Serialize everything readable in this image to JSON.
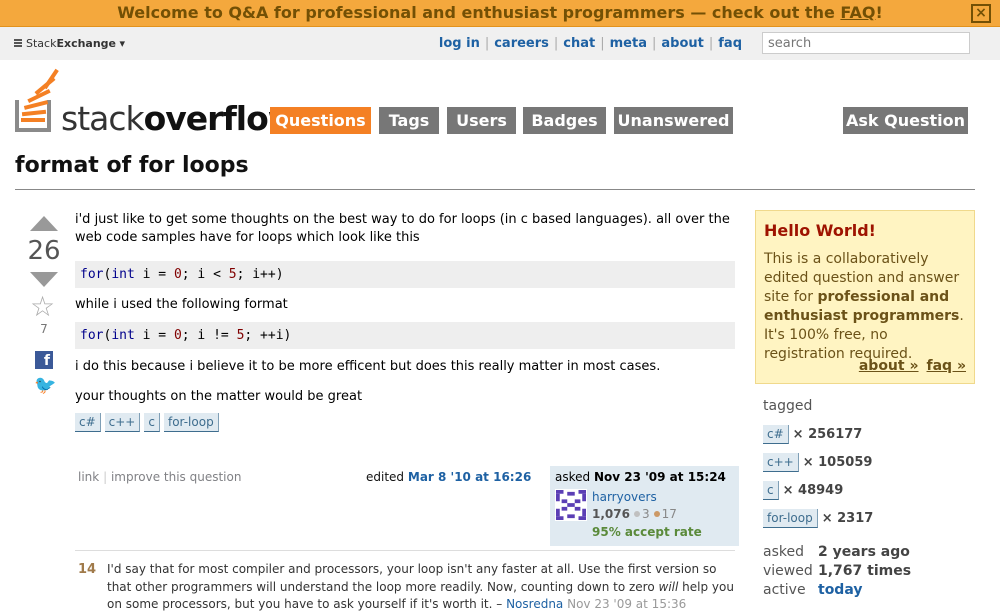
{
  "notify": {
    "text": "Welcome to Q&A for professional and enthusiast programmers — check out the ",
    "faq_link": "FAQ",
    "end": "!",
    "close": "×"
  },
  "topbar": {
    "brand": "StackExchange",
    "brand_prefix": "Stack",
    "brand_suffix": "Exchange",
    "caret": "▾",
    "links": [
      "log in",
      "careers",
      "chat",
      "meta",
      "about",
      "faq"
    ],
    "search_placeholder": "search"
  },
  "logo": {
    "light": "stack",
    "bold": "overflow"
  },
  "nav": {
    "items": [
      "Questions",
      "Tags",
      "Users",
      "Badges",
      "Unanswered"
    ],
    "ask": "Ask Question"
  },
  "question": {
    "title": "format of for loops",
    "votes": "26",
    "favorites": "7",
    "body1": "i'd just like to get some thoughts on the best way to do for loops (in c based languages). all over the web code samples have for loops which look like this",
    "code1": "for(int i = 0; i < 5; i++)",
    "body2": "while i used the following format",
    "code2": "for(int i = 0; i != 5; ++i)",
    "body3": "i do this because i believe it to be more efficent but does this really matter in most cases.",
    "body4": "your thoughts on the matter would be great",
    "tags": [
      "c#",
      "c++",
      "c",
      "for-loop"
    ],
    "menu_link": "link",
    "menu_improve": "improve this question",
    "edited_label": "edited",
    "edited_date": "Mar 8 '10 at 16:26",
    "asked_label": "asked",
    "asked_date": "Nov 23 '09 at 15:24",
    "user": "harryovers",
    "rep": "1,076",
    "silver": "3",
    "bronze": "17",
    "accept_rate": "95% accept rate"
  },
  "answer": {
    "votes": "14",
    "text_a": "I'd say that for most compiler and processors, your loop isn't any faster at all. Use the first version so that other programmers will understand the loop more readily. Now, counting down to zero ",
    "text_em": "will",
    "text_b": " help you on some processors, but you have to ask yourself if it's worth it. – ",
    "author": "Nosredna",
    "date": "Nov 23 '09 at 15:36"
  },
  "sidebar": {
    "hello_title": "Hello World!",
    "hello_text_a": "This is a collaboratively edited question and answer site for ",
    "hello_bold": "professional and enthusiast programmers",
    "hello_text_b": ". It's 100% free, no registration required.",
    "about_link": "about »",
    "faq_link": "faq »",
    "tagged_label": "tagged",
    "tags": [
      {
        "name": "c#",
        "count": "× 256177"
      },
      {
        "name": "c++",
        "count": "× 105059"
      },
      {
        "name": "c",
        "count": "× 48949"
      },
      {
        "name": "for-loop",
        "count": "× 2317"
      }
    ],
    "stats": [
      {
        "label": "asked",
        "value": "2 years ago"
      },
      {
        "label": "viewed",
        "value": "1,767 times"
      },
      {
        "label": "active",
        "value": "today"
      }
    ]
  },
  "colors": {
    "accent_orange": "#f48024",
    "notify_bg": "#f4a83d",
    "link_blue": "#1e61a3",
    "tag_bg": "#e0eaf1",
    "hello_bg": "#fff4c2"
  }
}
